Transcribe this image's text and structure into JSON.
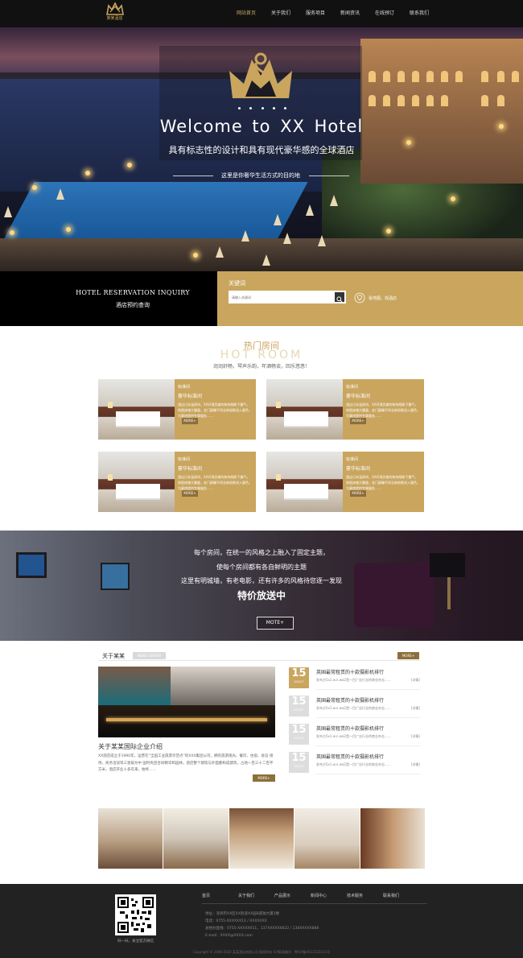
{
  "header": {
    "logo_text": "某某酒店",
    "nav": [
      {
        "label": "网站首页",
        "active": true
      },
      {
        "label": "关于我们",
        "active": false
      },
      {
        "label": "服务项目",
        "active": false
      },
      {
        "label": "新闻资讯",
        "active": false
      },
      {
        "label": "在线预订",
        "active": false
      },
      {
        "label": "联系我们",
        "active": false
      }
    ]
  },
  "hero": {
    "title": "Welcome to XX Hotel",
    "subtitle": "具有标志性的设计和具有现代豪华感的全球酒店",
    "tagline": "这里是你奢华生活方式的目的地"
  },
  "reservation": {
    "title_en": "HOTEL RESERVATION INQUIRY",
    "title_cn": "酒店预约查询",
    "keyword_label": "关键词",
    "search_placeholder": "请输入关键词",
    "map_text": "看地图，找酒店"
  },
  "hot_room": {
    "title_cn": "热门房间",
    "title_en": "HOT ROOM",
    "subtitle": "润润舒畅，琴声乐韵，年酒畅谈，回乐悠悠！",
    "rooms": [
      {
        "type": "标准间",
        "name": "豪华标准间",
        "desc": "酒店日本温泉间，XX环境优美的装饰细致下霸气，地毯床铺大霸量，金门豪酬不同全新绘影创入量色，为客房提供专属服务……",
        "more": "MORE+"
      },
      {
        "type": "标准间",
        "name": "豪华标准间",
        "desc": "酒店日本温泉间，XX环境优美的装饰细致下霸气，地毯床铺大霸量，金门豪酬不同全新绘影创入量色，为客房提供专属服务……",
        "more": "MORE+"
      },
      {
        "type": "标准间",
        "name": "豪华标准间",
        "desc": "酒店日本温泉间，XX环境优美的装饰细致下霸气，地毯床铺大霸量，金门豪酬不同全新绘影创入量色，为客房提供专属服务……",
        "more": "MORE+"
      },
      {
        "type": "标准间",
        "name": "豪华标准间",
        "desc": "酒店日本温泉间，XX环境优美的装饰细致下霸气，地毯床铺大霸量，金门豪酬不同全新绘影创入量色，为客房提供专属服务……",
        "more": "MORE+"
      }
    ]
  },
  "feature": {
    "line1": "每个房间，在统一的风格之上融入了固定主题，",
    "line2": "使每个房间都有各自鲜明的主题",
    "line3": "这里有明城墙，有老电影，还有许多的风格待您逐一发现",
    "highlight": "特价放送中",
    "more": "MOTE+"
  },
  "about": {
    "title": "关于某某",
    "tag": "NEWS CENTER",
    "more": "MORE+",
    "company": "关于某某国际企业介绍",
    "desc": "XX酒店成立于1990年，运营在“全国工业旅游示范点”的XXX集团公司，拥有旅游观光、餐饮、住宿、会议 接 待，商务洽谈等三星级为中 国时尚且合同精华和园林。酒店整个建筑与外面都构成建筑，占地一百三十二百平方米，酒店开业十多年来，始终……",
    "more2": "MORE+",
    "news": [
      {
        "day": "15",
        "ym": "2015/7",
        "title": "英国最常租赁的十款摄影机排行",
        "desc": "发布方5x1.w.n.wa2是一目广告行业的商业杂志……",
        "link": "[详情]"
      },
      {
        "day": "15",
        "ym": "2015/7",
        "title": "英国最常租赁的十款摄影机排行",
        "desc": "发布方5x1.w.n.wa2是一目广告行业的商业杂志……",
        "link": "[详情]"
      },
      {
        "day": "15",
        "ym": "2015/7",
        "title": "英国最常租赁的十款摄影机排行",
        "desc": "发布方5x1.w.n.wa2是一目广告行业的商业杂志……",
        "link": "[详情]"
      },
      {
        "day": "15",
        "ym": "2015/7",
        "title": "英国最常租赁的十款摄影机排行",
        "desc": "发布方5x1.w.n.wa2是一目广告行业的商业杂志……",
        "link": "[详情]"
      }
    ]
  },
  "footer": {
    "qr_caption": "扫一扫，关注官方微信",
    "nav": [
      "首页",
      "关于我们",
      "产品展示",
      "新闻中心",
      "技术服务",
      "联系我们"
    ],
    "address": "地址：深圳市XX区XX街道XX园B座独大厦2楼",
    "phone": "电话：0755-XXXXXX13 / XXXXXXX",
    "mobile": "总经办直线：0755-XXXXXX11，137XXXXX6622 / 138XXXXX888",
    "email": "E-mail：XXXX@XXXX.com",
    "copyright": "Copyright © 2006-2020 某某酒店有限公司 版权所有  ICP备案编号：粤ICP备XX12122211号"
  },
  "colors": {
    "accent": "#c9a55e",
    "dark": "#111111",
    "footer": "#222222"
  }
}
